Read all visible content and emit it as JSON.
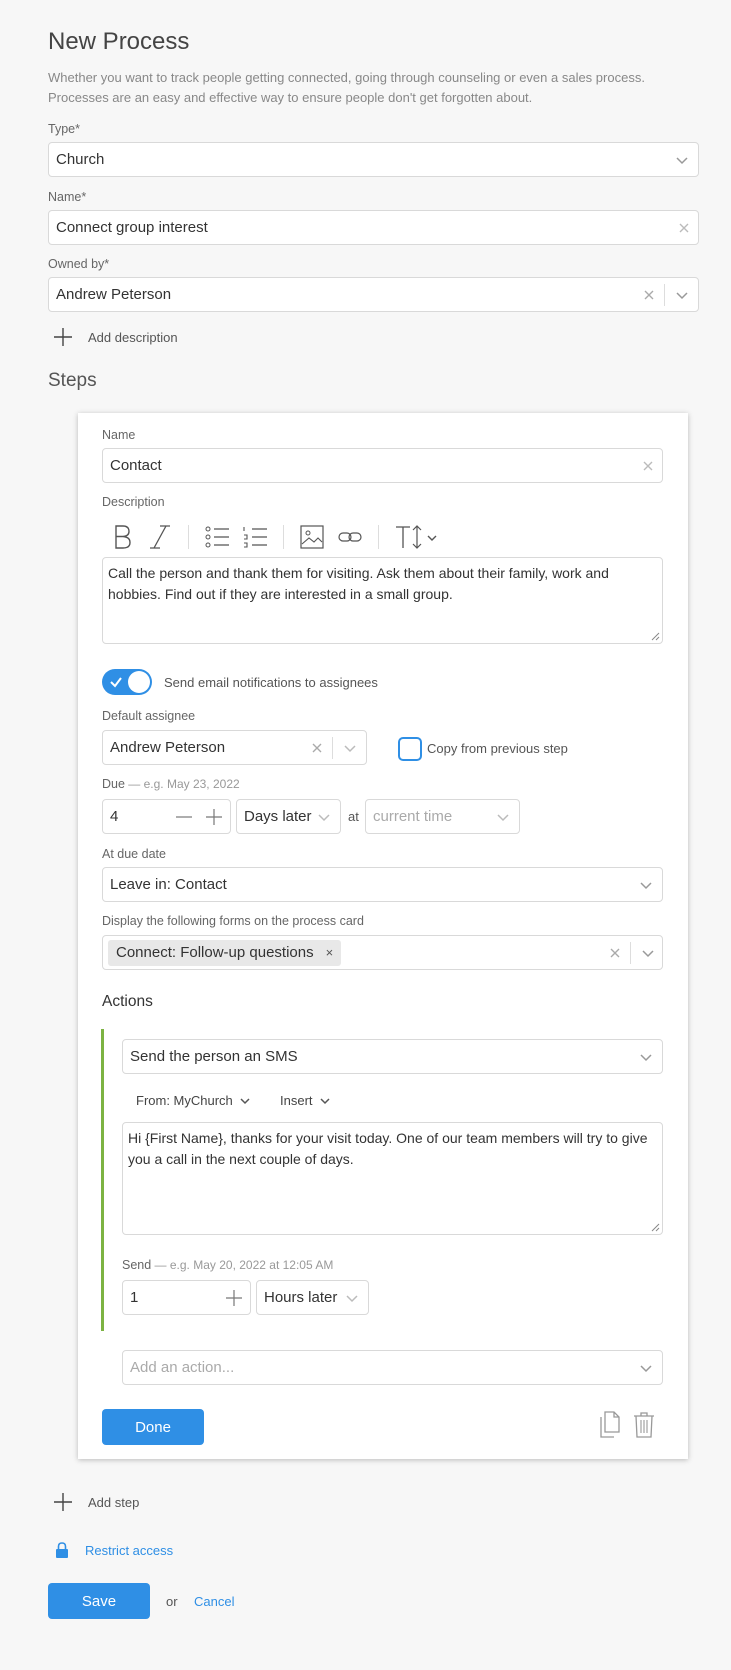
{
  "header": {
    "title": "New Process",
    "subtitle_line1": "Whether you want to track people getting connected, going through counseling or even a sales process.",
    "subtitle_line2": "Processes are an easy and effective way to ensure people don't get forgotten about."
  },
  "form": {
    "type_label": "Type*",
    "type_value": "Church",
    "name_label": "Name*",
    "name_value": "Connect group interest",
    "owner_label": "Owned by*",
    "owner_value": "Andrew Peterson",
    "add_description": "Add description"
  },
  "steps": {
    "title": "Steps",
    "step": {
      "name_label": "Name",
      "name_value": "Contact",
      "description_label": "Description",
      "description_text": "Call the person and thank them for visiting. Ask them about their family, work and hobbies. Find out if they are interested in a small group.",
      "notify_label": "Send email notifications to assignees",
      "notify_on": true,
      "assignee_label": "Default assignee",
      "assignee_value": "Andrew Peterson",
      "copy_label": "Copy from previous step",
      "due_label": "Due",
      "due_example": " — e.g. May 23, 2022",
      "due_amount": "4",
      "due_unit": "Days later",
      "at_label": "at",
      "due_time_placeholder": "current time",
      "at_due_label": "At due date",
      "at_due_value": "Leave in: Contact",
      "forms_label": "Display the following forms on the process card",
      "forms_chip": "Connect: Follow-up questions",
      "actions_title": "Actions",
      "action": {
        "type": "Send the person an SMS",
        "from": "From: MyChurch",
        "insert": "Insert",
        "message": "Hi {First Name}, thanks for your visit today. One of our team members will try to give you a call in the next couple of days.",
        "send_label": "Send",
        "send_example": " — e.g. May 20, 2022 at 12:05 AM",
        "send_amount": "1",
        "send_unit": "Hours later"
      },
      "add_action_placeholder": "Add an action...",
      "done_label": "Done"
    }
  },
  "footer": {
    "add_step": "Add step",
    "restrict_access": "Restrict access",
    "save_label": "Save",
    "or_label": "or",
    "cancel_label": "Cancel"
  },
  "colors": {
    "accent": "#2f8fe5",
    "action_bar": "#7cb342",
    "background": "#f7f7f7"
  }
}
